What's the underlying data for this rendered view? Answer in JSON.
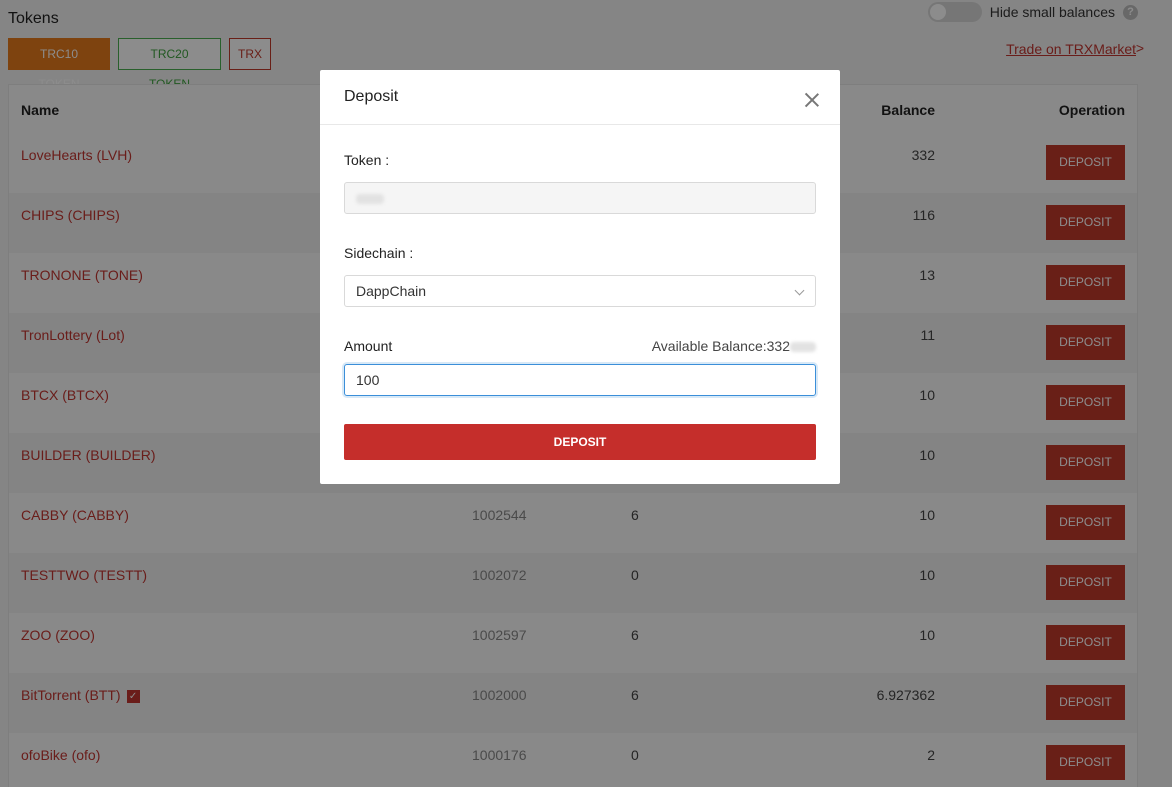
{
  "page": {
    "title": "Tokens",
    "hide_small_label": "Hide small balances",
    "help": "?",
    "tabs": [
      "TRC10 TOKEN",
      "TRC20 TOKEN",
      "TRX"
    ],
    "trade_link": "Trade on TRXMarket",
    "trade_arrow": ">"
  },
  "table": {
    "headers": {
      "name": "Name",
      "balance": "Balance",
      "operation": "Operation"
    },
    "rows": [
      {
        "name": "LoveHearts (LVH)",
        "id": "",
        "precision": "",
        "balance": "332",
        "action": "DEPOSIT"
      },
      {
        "name": "CHIPS (CHIPS)",
        "id": "",
        "precision": "",
        "balance": "116",
        "action": "DEPOSIT"
      },
      {
        "name": "TRONONE (TONE)",
        "id": "",
        "precision": "",
        "balance": "13",
        "action": "DEPOSIT"
      },
      {
        "name": "TronLottery (Lot)",
        "id": "",
        "precision": "",
        "balance": "11",
        "action": "DEPOSIT"
      },
      {
        "name": "BTCX (BTCX)",
        "id": "",
        "precision": "",
        "balance": "10",
        "action": "DEPOSIT"
      },
      {
        "name": "BUILDER (BUILDER)",
        "id": "",
        "precision": "",
        "balance": "10",
        "action": "DEPOSIT"
      },
      {
        "name": "CABBY (CABBY)",
        "id": "1002544",
        "precision": "6",
        "balance": "10",
        "action": "DEPOSIT"
      },
      {
        "name": "TESTTWO (TESTT)",
        "id": "1002072",
        "precision": "0",
        "balance": "10",
        "action": "DEPOSIT"
      },
      {
        "name": "ZOO (ZOO)",
        "id": "1002597",
        "precision": "6",
        "balance": "10",
        "action": "DEPOSIT"
      },
      {
        "name": "BitTorrent (BTT)",
        "id": "1002000",
        "precision": "6",
        "balance": "6.927362",
        "action": "DEPOSIT",
        "verified": "✓"
      },
      {
        "name": "ofoBike (ofo)",
        "id": "1000176",
        "precision": "0",
        "balance": "2",
        "action": "DEPOSIT"
      }
    ]
  },
  "modal": {
    "title": "Deposit",
    "token_label": "Token :",
    "sidechain_label": "Sidechain :",
    "sidechain_value": "DappChain",
    "amount_label": "Amount",
    "available_label": "Available Balance:332",
    "amount_value": "100",
    "submit_label": "DEPOSIT"
  },
  "colors": {
    "accent_red": "#c0392b",
    "trc10_orange": "#e57a1d",
    "trc20_green": "#3fa23f"
  }
}
